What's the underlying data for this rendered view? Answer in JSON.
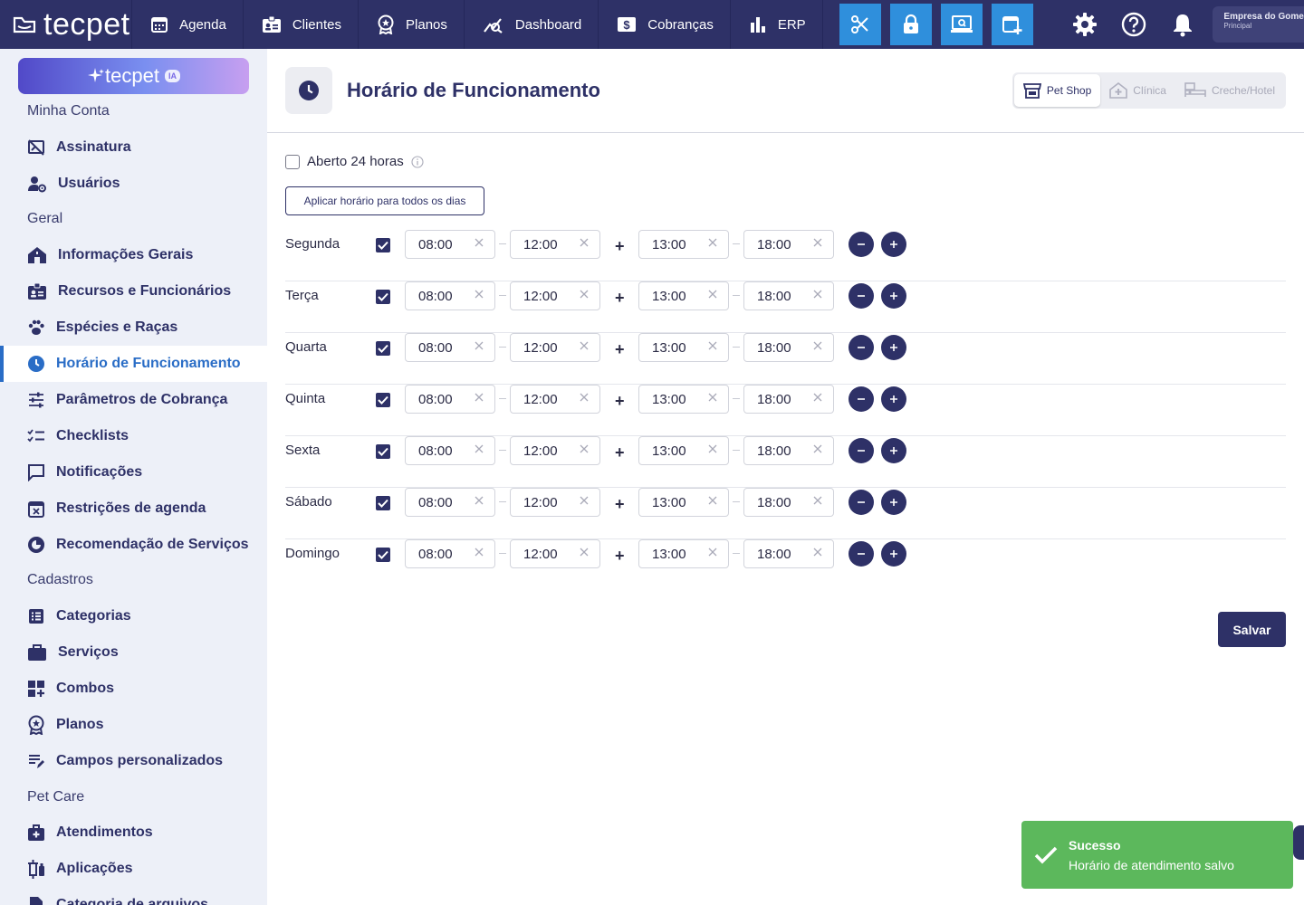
{
  "brand": {
    "logo_text": "tecpet",
    "ia_label": "tecpet",
    "ia_badge": "IA"
  },
  "nav": [
    {
      "label": "Agenda",
      "icon": "calendar-icon"
    },
    {
      "label": "Clientes",
      "icon": "clients-icon"
    },
    {
      "label": "Planos",
      "icon": "plans-icon"
    },
    {
      "label": "Dashboard",
      "icon": "dashboard-icon"
    },
    {
      "label": "Cobranças",
      "icon": "billing-icon"
    },
    {
      "label": "ERP",
      "icon": "erp-icon"
    }
  ],
  "company": {
    "name": "Empresa do Gomes",
    "subtitle": "Principal"
  },
  "sidebar": {
    "sections": {
      "minha_conta": "Minha Conta",
      "geral": "Geral",
      "cadastros": "Cadastros",
      "pet_care": "Pet Care"
    },
    "items": {
      "assinatura": "Assinatura",
      "usuarios": "Usuários",
      "informacoes": "Informações Gerais",
      "recursos": "Recursos e Funcionários",
      "especies": "Espécies e Raças",
      "horario": "Horário de Funcionamento",
      "parametros": "Parâmetros de Cobrança",
      "checklists": "Checklists",
      "notificacoes": "Notificações",
      "restricoes": "Restrições de agenda",
      "recomendacao": "Recomendação de Serviços",
      "categorias": "Categorias",
      "servicos": "Serviços",
      "combos": "Combos",
      "planos": "Planos",
      "campos": "Campos personalizados",
      "atendimentos": "Atendimentos",
      "aplicacoes": "Aplicações",
      "categoria_arquivos": "Categoria de arquivos"
    }
  },
  "page": {
    "title": "Horário de Funcionamento",
    "segments": [
      "Pet Shop",
      "Clínica",
      "Creche/Hotel"
    ],
    "open24_label": "Aberto 24 horas",
    "apply_label": "Aplicar horário para todos os dias",
    "save_label": "Salvar",
    "days": [
      {
        "name": "Segunda",
        "checked": true,
        "t1": "08:00",
        "t2": "12:00",
        "t3": "13:00",
        "t4": "18:00"
      },
      {
        "name": "Terça",
        "checked": true,
        "t1": "08:00",
        "t2": "12:00",
        "t3": "13:00",
        "t4": "18:00"
      },
      {
        "name": "Quarta",
        "checked": true,
        "t1": "08:00",
        "t2": "12:00",
        "t3": "13:00",
        "t4": "18:00"
      },
      {
        "name": "Quinta",
        "checked": true,
        "t1": "08:00",
        "t2": "12:00",
        "t3": "13:00",
        "t4": "18:00"
      },
      {
        "name": "Sexta",
        "checked": true,
        "t1": "08:00",
        "t2": "12:00",
        "t3": "13:00",
        "t4": "18:00"
      },
      {
        "name": "Sábado",
        "checked": true,
        "t1": "08:00",
        "t2": "12:00",
        "t3": "13:00",
        "t4": "18:00"
      },
      {
        "name": "Domingo",
        "checked": true,
        "t1": "08:00",
        "t2": "12:00",
        "t3": "13:00",
        "t4": "18:00"
      }
    ]
  },
  "toast": {
    "title": "Sucesso",
    "message": "Horário de atendimento salvo"
  },
  "colors": {
    "primary": "#2e3167",
    "accent": "#2f8fdc",
    "active": "#2a6dc6",
    "success": "#5cb85c",
    "sidebar_bg": "#edf0f8"
  }
}
